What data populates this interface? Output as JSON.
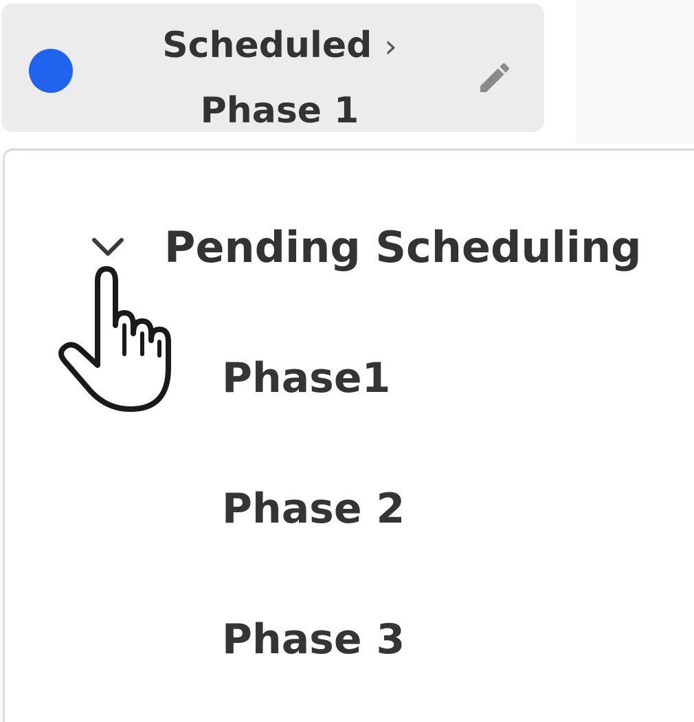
{
  "status_chip": {
    "status_dot_color": "#1f63ee",
    "line1": "Scheduled",
    "separator": "›",
    "line2": "Phase 1",
    "edit_icon": "pencil-icon"
  },
  "dropdown": {
    "group": {
      "label": "Pending Scheduling",
      "expanded": true,
      "chevron_icon": "chevron-down-icon"
    },
    "options": [
      "Phase1",
      "Phase 2",
      "Phase 3"
    ]
  },
  "cursor": "hand-pointer-icon"
}
